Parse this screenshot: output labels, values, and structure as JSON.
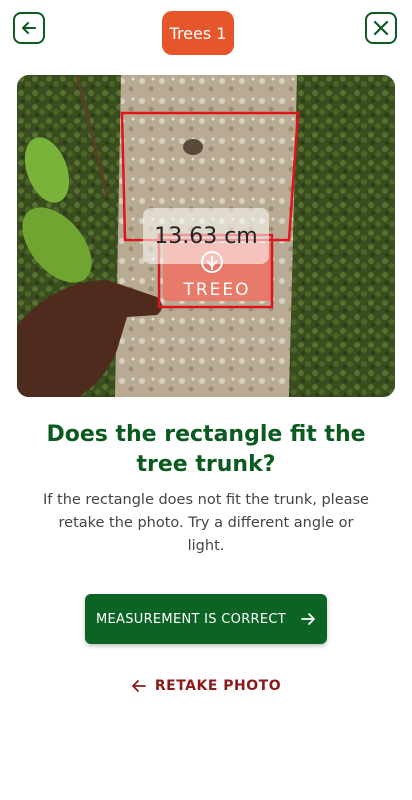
{
  "header": {
    "back_icon": "arrow-left-icon",
    "title": "Trees 1",
    "close_icon": "close-icon",
    "accent": "#e5562a",
    "brand_green": "#0e5a24"
  },
  "photo": {
    "measurement": "13.63 cm",
    "card_text": "TREEO",
    "rectangle_color": "#e0151b"
  },
  "prompt": {
    "question": "Does the rectangle fit the tree trunk?",
    "hint": "If the rectangle does not fit the trunk, please retake the photo. Try a different angle or light."
  },
  "actions": {
    "confirm_label": "MEASUREMENT IS CORRECT",
    "confirm_icon": "arrow-right-icon",
    "retake_label": "RETAKE PHOTO",
    "retake_icon": "arrow-left-icon"
  }
}
